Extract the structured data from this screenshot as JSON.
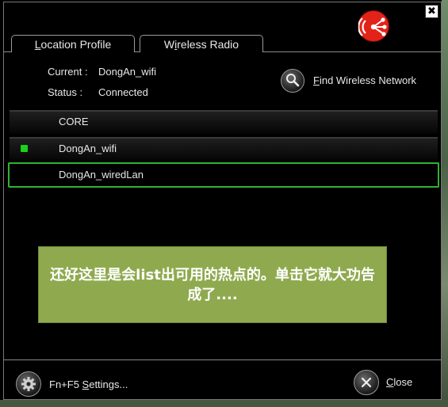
{
  "window": {
    "close_glyph": "✖",
    "brand_logo_icon": "share-broadcast-icon",
    "brand_color": "#e2231a"
  },
  "tabs": [
    {
      "label_mnemonic": "L",
      "label_rest": "ocation Profile"
    },
    {
      "label_pre": "W",
      "label_mnemonic": "i",
      "label_rest": "reless Radio"
    }
  ],
  "current_info": {
    "current_label": "Current :",
    "current_value": "DongAn_wifi",
    "status_label": "Status :",
    "status_value": "Connected"
  },
  "find_network": {
    "icon": "magnifier-icon",
    "label_mnemonic": "F",
    "label_rest": "ind Wireless Network"
  },
  "profiles": [
    {
      "name": "CORE",
      "active": false,
      "selected": false
    },
    {
      "name": "DongAn_wifi",
      "active": true,
      "selected": false
    },
    {
      "name": "DongAn_wiredLan",
      "active": false,
      "selected": true
    }
  ],
  "overlay_note": "还好这里是会list出可用的热点的。单击它就大功告成了....",
  "footer": {
    "settings_icon": "gear-icon",
    "settings_prefix": "Fn+F5 ",
    "settings_mnemonic": "S",
    "settings_rest": "ettings...",
    "close_icon": "close-icon",
    "close_mnemonic": "C",
    "close_rest": "lose"
  },
  "colors": {
    "active_dot": "#1ad21a",
    "selected_border": "#31b331",
    "overlay_bg": "#8faa4e"
  }
}
